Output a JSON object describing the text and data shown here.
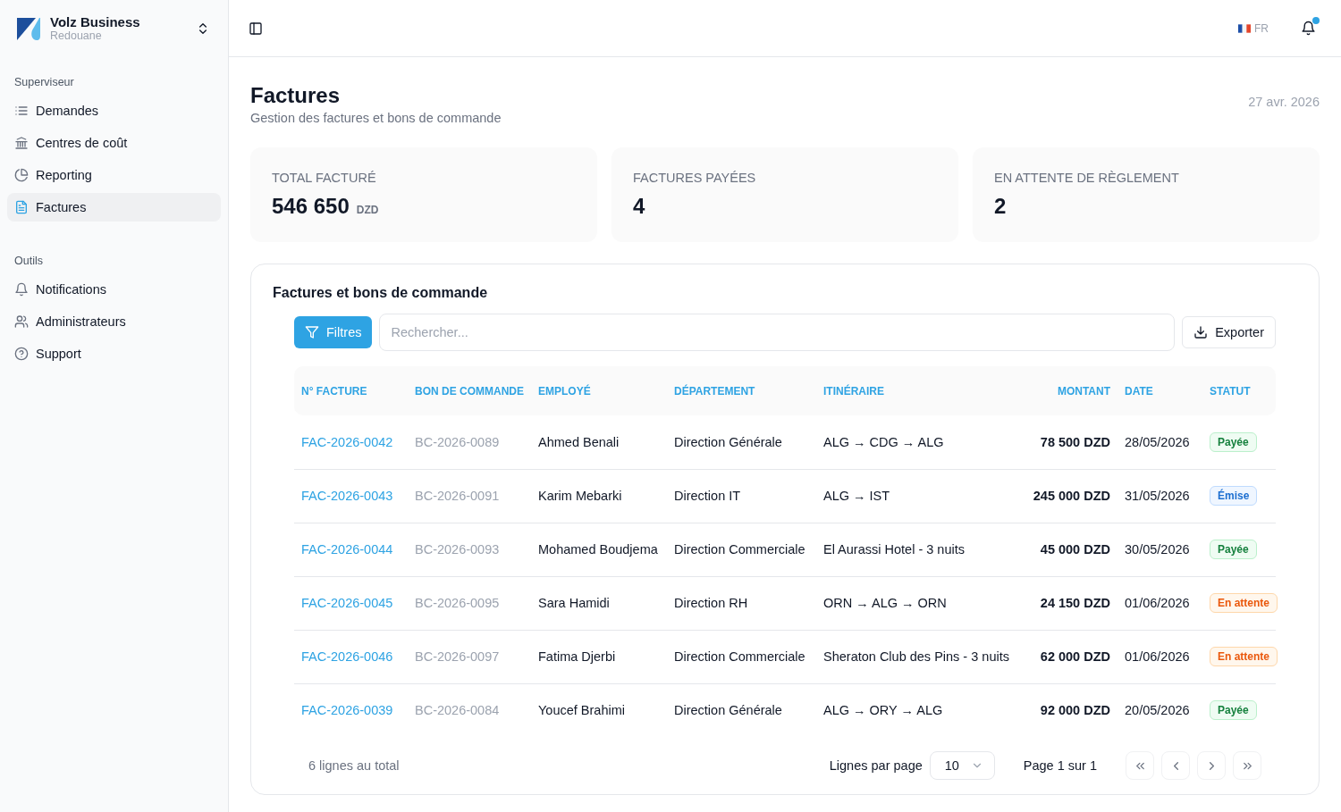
{
  "sidebar": {
    "brand": {
      "name": "Volz Business",
      "user": "Redouane"
    },
    "sections": [
      {
        "title": "Superviseur",
        "items": [
          {
            "label": "Demandes",
            "selected": false
          },
          {
            "label": "Centres de coût",
            "selected": false
          },
          {
            "label": "Reporting",
            "selected": false
          },
          {
            "label": "Factures",
            "selected": true
          }
        ]
      },
      {
        "title": "Outils",
        "items": [
          {
            "label": "Notifications",
            "selected": false
          },
          {
            "label": "Administrateurs",
            "selected": false
          },
          {
            "label": "Support",
            "selected": false
          }
        ]
      }
    ]
  },
  "header": {
    "language": "FR",
    "notifications": {
      "unread": true
    }
  },
  "page": {
    "title": "Factures",
    "subtitle": "Gestion des factures et bons de commande",
    "date": "27 avr. 2026"
  },
  "stats": [
    {
      "label": "TOTAL FACTURÉ",
      "value": "546 650",
      "unit": "DZD"
    },
    {
      "label": "FACTURES PAYÉES",
      "value": "4"
    },
    {
      "label": "EN ATTENTE DE RÈGLEMENT",
      "value": "2"
    }
  ],
  "table_card": {
    "title": "Factures et bons de commande",
    "filter_button": "Filtres",
    "search": {
      "placeholder": "Rechercher..."
    },
    "export_button": "Exporter",
    "table": {
      "columns": [
        "N° FACTURE",
        "BON DE COMMANDE",
        "EMPLOYÉ",
        "DÉPARTEMENT",
        "ITINÉRAIRE",
        "MONTANT",
        "DATE",
        "STATUT"
      ],
      "rows": [
        {
          "invoice": "FAC-2026-0042",
          "order": "BC-2026-0089",
          "employee": "Ahmed Benali",
          "department": "Direction Générale",
          "itinerary": "ALG → CDG → ALG",
          "amount": "78 500 DZD",
          "date": "28/05/2026",
          "status": {
            "label": "Payée",
            "kind": "paid"
          }
        },
        {
          "invoice": "FAC-2026-0043",
          "order": "BC-2026-0091",
          "employee": "Karim Mebarki",
          "department": "Direction IT",
          "itinerary": "ALG → IST",
          "amount": "245 000 DZD",
          "date": "31/05/2026",
          "status": {
            "label": "Émise",
            "kind": "issued"
          }
        },
        {
          "invoice": "FAC-2026-0044",
          "order": "BC-2026-0093",
          "employee": "Mohamed Boudjema",
          "department": "Direction Commerciale",
          "itinerary": "El Aurassi Hotel - 3 nuits",
          "amount": "45 000 DZD",
          "date": "30/05/2026",
          "status": {
            "label": "Payée",
            "kind": "paid"
          }
        },
        {
          "invoice": "FAC-2026-0045",
          "order": "BC-2026-0095",
          "employee": "Sara Hamidi",
          "department": "Direction RH",
          "itinerary": "ORN → ALG → ORN",
          "amount": "24 150 DZD",
          "date": "01/06/2026",
          "status": {
            "label": "En attente",
            "kind": "pending"
          }
        },
        {
          "invoice": "FAC-2026-0046",
          "order": "BC-2026-0097",
          "employee": "Fatima Djerbi",
          "department": "Direction Commerciale",
          "itinerary": "Sheraton Club des Pins - 3 nuits",
          "amount": "62 000 DZD",
          "date": "01/06/2026",
          "status": {
            "label": "En attente",
            "kind": "pending"
          }
        },
        {
          "invoice": "FAC-2026-0039",
          "order": "BC-2026-0084",
          "employee": "Youcef Brahimi",
          "department": "Direction Générale",
          "itinerary": "ALG → ORY → ALG",
          "amount": "92 000 DZD",
          "date": "20/05/2026",
          "status": {
            "label": "Payée",
            "kind": "paid"
          }
        }
      ]
    },
    "footer": {
      "total": "6 lignes au total",
      "rows_per_page_label": "Lignes par page",
      "rows_per_page": "10",
      "page": "Page 1 sur 1",
      "buttons": [
        {
          "kind": "first",
          "disabled": true
        },
        {
          "kind": "previous",
          "disabled": true
        },
        {
          "kind": "next",
          "disabled": true
        },
        {
          "kind": "last",
          "disabled": true
        }
      ]
    }
  }
}
